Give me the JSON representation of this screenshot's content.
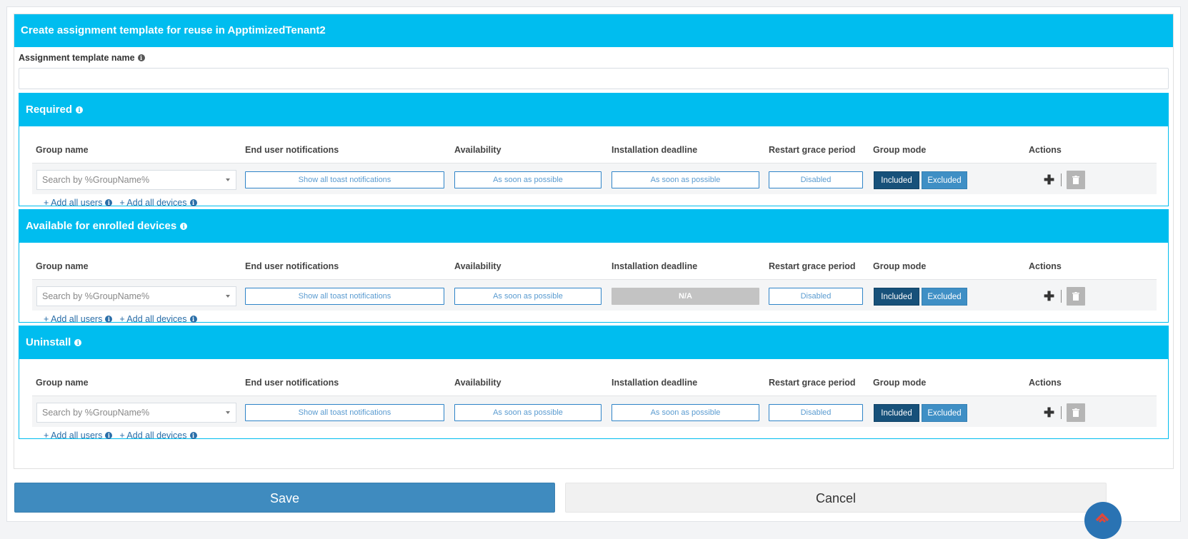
{
  "modal": {
    "title": "Create assignment template for reuse in ApptimizedTenant2",
    "template_name_label": "Assignment template name",
    "template_name_value": ""
  },
  "columns": {
    "group_name": "Group name",
    "notifications": "End user notifications",
    "availability": "Availability",
    "deadline": "Installation deadline",
    "restart": "Restart grace period",
    "group_mode": "Group mode",
    "actions": "Actions"
  },
  "sections": [
    {
      "title": "Required",
      "group_placeholder": "Search by %GroupName%",
      "notifications": "Show all toast notifications",
      "availability": "As soon as possible",
      "deadline": "As soon as possible",
      "restart": "Disabled",
      "included_label": "Included",
      "excluded_label": "Excluded",
      "add_users": "+ Add all users",
      "add_devices": "+ Add all devices"
    },
    {
      "title": "Available for enrolled devices",
      "group_placeholder": "Search by %GroupName%",
      "notifications": "Show all toast notifications",
      "availability": "As soon as possible",
      "deadline": "N/A",
      "restart": "Disabled",
      "included_label": "Included",
      "excluded_label": "Excluded",
      "add_users": "+ Add all users",
      "add_devices": "+ Add all devices"
    },
    {
      "title": "Uninstall",
      "group_placeholder": "Search by %GroupName%",
      "notifications": "Show all toast notifications",
      "availability": "As soon as possible",
      "deadline": "As soon as possible",
      "restart": "Disabled",
      "included_label": "Included",
      "excluded_label": "Excluded",
      "add_users": "+ Add all users",
      "add_devices": "+ Add all devices"
    }
  ],
  "footer": {
    "save_label": "Save",
    "cancel_label": "Cancel"
  },
  "colors": {
    "header": "#00bdef",
    "included": "#17517a",
    "excluded": "#3f8fc5",
    "save": "#3f8bbf"
  }
}
